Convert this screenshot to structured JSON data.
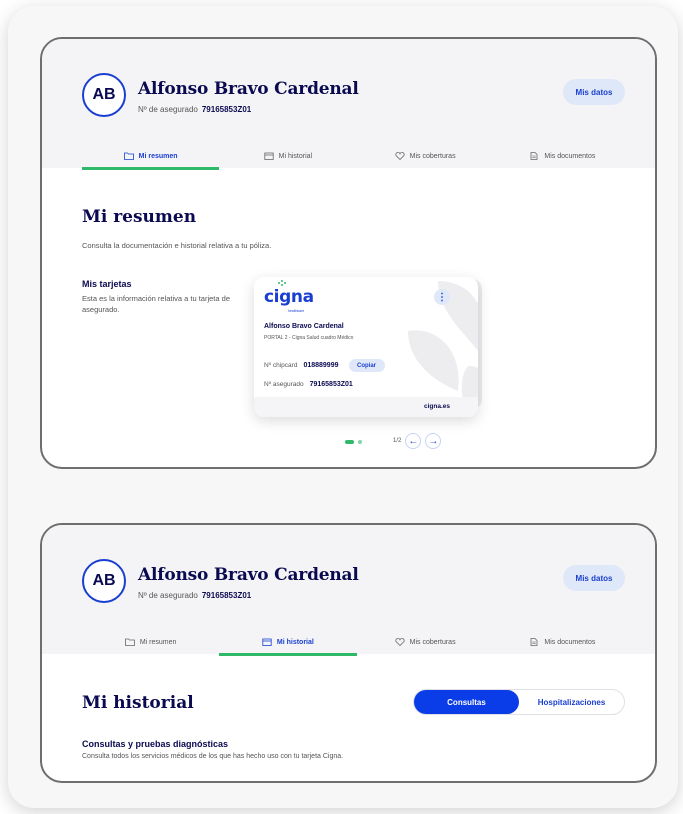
{
  "panel1": {
    "avatar_initials": "AB",
    "user_name": "Alfonso Bravo Cardenal",
    "policy_label": "Nº de asegurado",
    "policy_number": "79165853Z01",
    "datos_button": "Mis datos",
    "tabs": [
      {
        "label": "Mi resumen",
        "icon": "folder-icon",
        "active": true
      },
      {
        "label": "Mi historial",
        "icon": "calendar-icon",
        "active": false
      },
      {
        "label": "Mis coberturas",
        "icon": "heart-icon",
        "active": false
      },
      {
        "label": "Mis documentos",
        "icon": "document-icon",
        "active": false
      }
    ],
    "section_title": "Mi resumen",
    "section_subtitle": "Consulta la documentación e historial relativa a tu póliza.",
    "cards_title": "Mis tarjetas",
    "cards_description": "Esta es la información relativa a tu tarjeta de asegurado.",
    "card": {
      "brand": "cigna",
      "brand_sub": "healthcare",
      "holder": "Alfonso Bravo Cardenal",
      "plan": "PORTAL 2 - Cigna Salud cuadro Médico",
      "chipcard_label": "Nº chipcard",
      "chipcard_value": "018889999",
      "copy_label": "Copiar",
      "asegurado_label": "Nº asegurado",
      "asegurado_value": "79165853Z01",
      "footer": "cigna.es",
      "menu_icon": "kebab-menu-icon"
    },
    "pager_text": "1/2",
    "pager": {
      "current": 1,
      "total": 2
    }
  },
  "panel2": {
    "avatar_initials": "AB",
    "user_name": "Alfonso Bravo Cardenal",
    "policy_label": "Nº de asegurado",
    "policy_number": "79165853Z01",
    "datos_button": "Mis datos",
    "tabs": [
      {
        "label": "Mi resumen",
        "icon": "folder-icon",
        "active": false
      },
      {
        "label": "Mi historial",
        "icon": "calendar-icon",
        "active": true
      },
      {
        "label": "Mis coberturas",
        "icon": "heart-icon",
        "active": false
      },
      {
        "label": "Mis documentos",
        "icon": "document-icon",
        "active": false
      }
    ],
    "section_title": "Mi historial",
    "segments": [
      "Consultas",
      "Hospitalizaciones"
    ],
    "segment_active": "Consultas",
    "history_title": "Consultas y pruebas diagnósticas",
    "history_description": "Consulta todos los servicios médicos de los que has hecho uso con tu tarjeta Cigna."
  },
  "colors": {
    "brand_blue": "#1a3fd0",
    "navy": "#0a0a50",
    "active_green": "#2fba6a",
    "segment_blue": "#0a3ce8"
  }
}
